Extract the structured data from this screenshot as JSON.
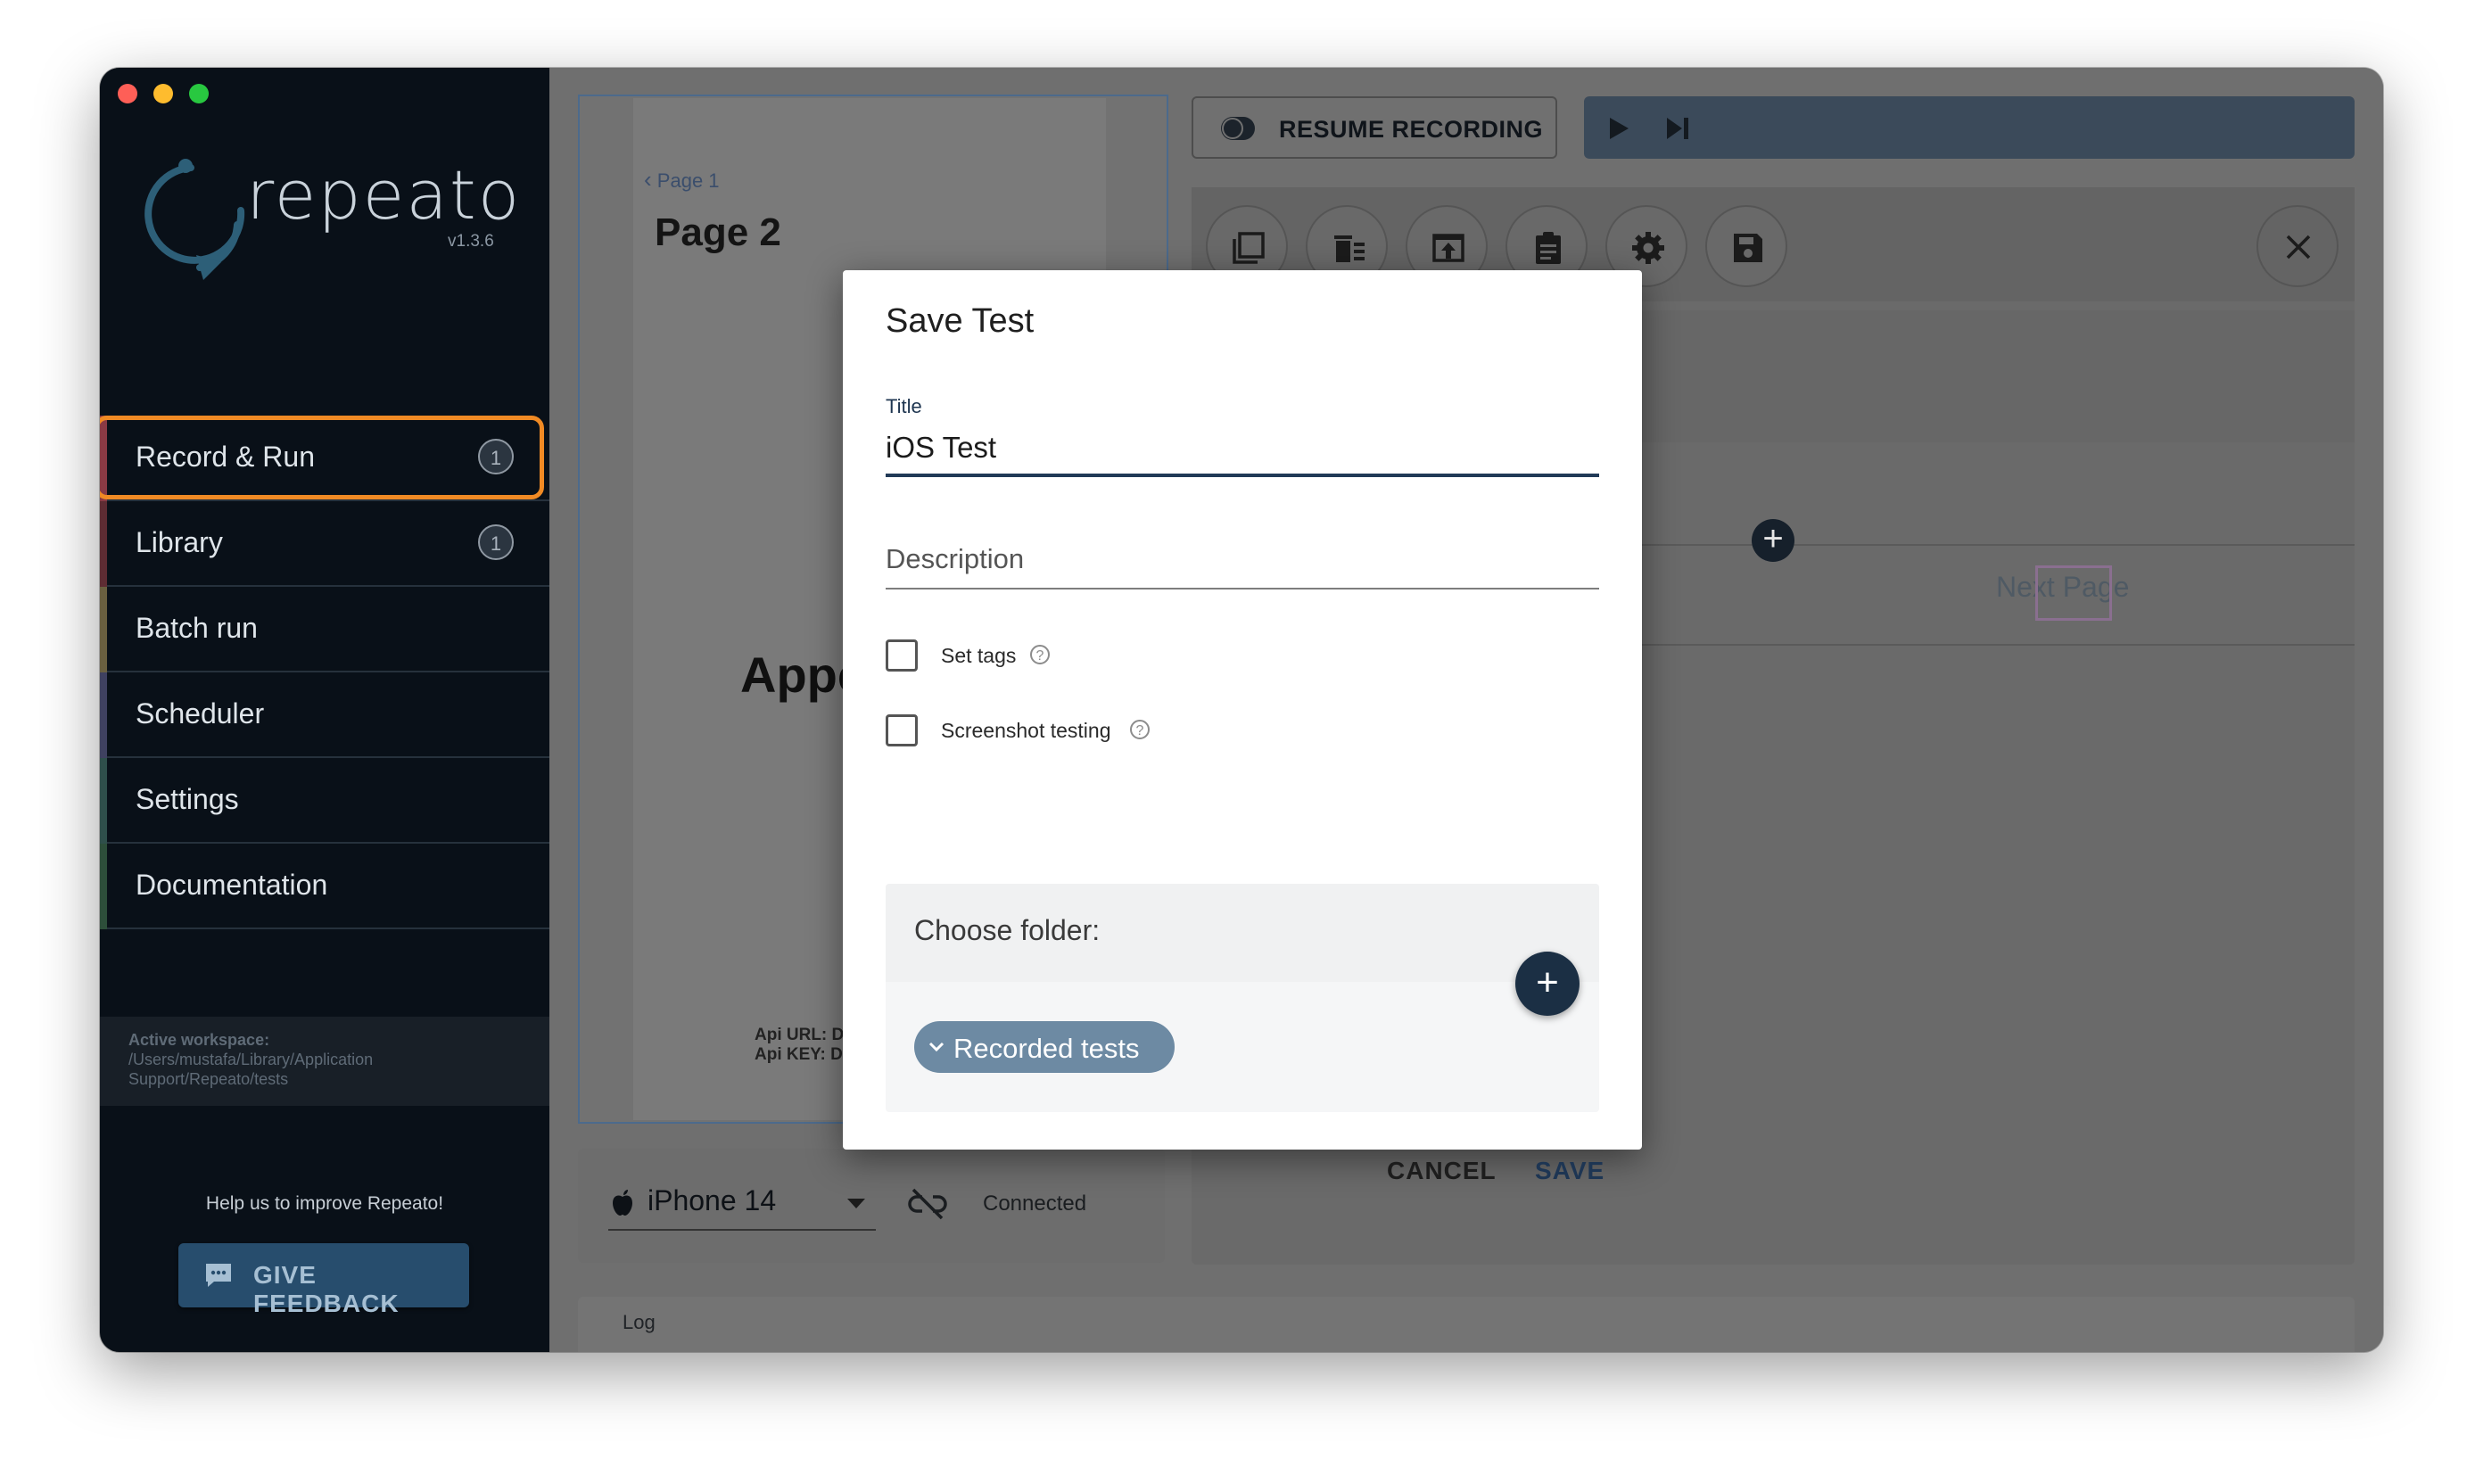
{
  "app": {
    "name": "repeato",
    "version": "v1.3.6"
  },
  "sidebar": {
    "items": [
      {
        "label": "Record & Run",
        "badge": "1",
        "color": "#c0444e"
      },
      {
        "label": "Library",
        "badge": "1",
        "color": "#8a3c44"
      },
      {
        "label": "Batch run",
        "color": "#9a8a52"
      },
      {
        "label": "Scheduler",
        "color": "#5c5f87"
      },
      {
        "label": "Settings",
        "color": "#3f6d67"
      },
      {
        "label": "Documentation",
        "color": "#3b6b4d"
      }
    ],
    "workspace_lines": [
      "Active workspace:",
      "/Users/mustafa/Library/Application",
      "Support/Repeato/tests"
    ],
    "help_text": "Help us to improve Repeato!",
    "feedback_label": "GIVE FEEDBACK"
  },
  "device_preview": {
    "back_label": "Page 1",
    "page_title": "Page 2",
    "app_text": "Appc",
    "api_url_label": "Api URL: D",
    "api_key_label": "Api KEY: D"
  },
  "toolbar": {
    "resume_label": "RESUME RECORDING",
    "icons": [
      "copy-icon",
      "delete-steps-icon",
      "export-icon",
      "clipboard-icon",
      "gear-icon",
      "save-icon"
    ]
  },
  "steps": {
    "next_page_text": "Next Page"
  },
  "device_bar": {
    "device_name": "iPhone 14",
    "status": "Connected"
  },
  "log": {
    "label": "Log"
  },
  "dialog": {
    "title": "Save Test",
    "title_field_label": "Title",
    "title_value": "iOS Test",
    "description_placeholder": "Description",
    "set_tags_label": "Set tags",
    "screenshot_testing_label": "Screenshot testing",
    "choose_folder_label": "Choose folder:",
    "folder_chip": "Recorded tests",
    "cancel_label": "CANCEL",
    "save_label": "SAVE"
  },
  "colors": {
    "accent_orange": "#f08a24",
    "primary_navy": "#1b2f44",
    "sidebar_bg": "#091018"
  }
}
